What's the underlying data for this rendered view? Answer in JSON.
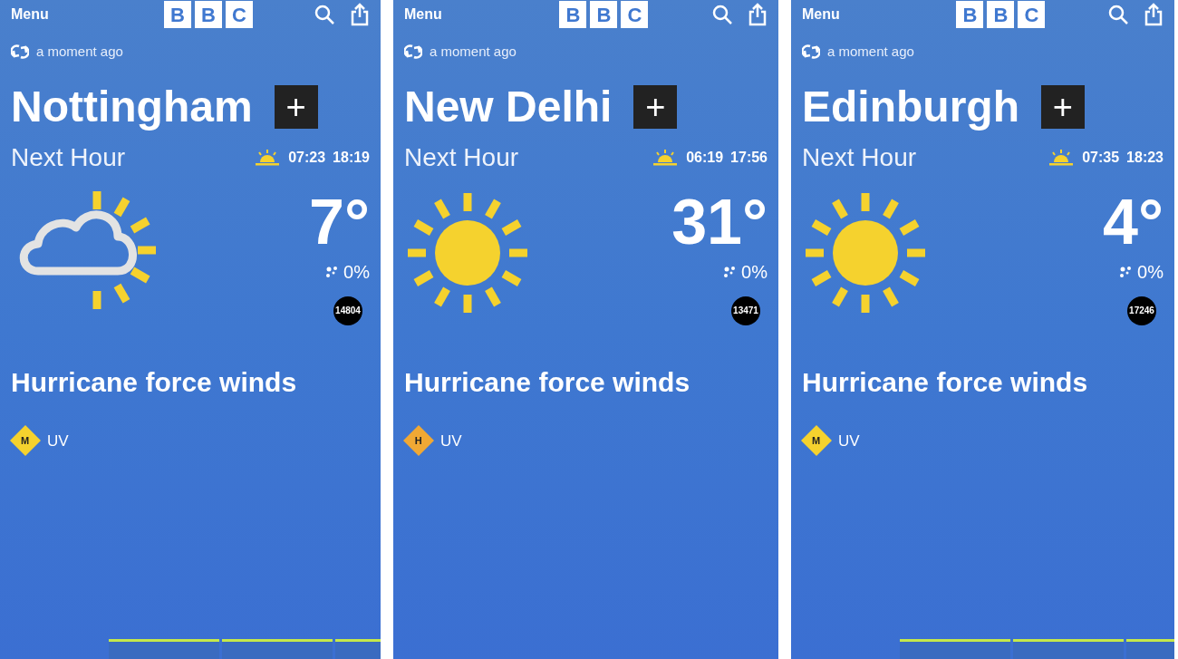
{
  "panels": [
    {
      "menu": "Menu",
      "logo": [
        "B",
        "B",
        "C"
      ],
      "updated": "a moment ago",
      "city": "Nottingham",
      "add": "+",
      "subtitle": "Next Hour",
      "sunrise": "07:23",
      "sunset": "18:19",
      "weather_icon": {
        "kind": "sun-cloud"
      },
      "temperature": "7°",
      "rain": "0%",
      "counter": "14804",
      "headline": "Hurricane force winds",
      "uv": {
        "level": "M",
        "label": "UV",
        "color": "#f5d22e"
      },
      "tab_strip": true
    },
    {
      "menu": "Menu",
      "logo": [
        "B",
        "B",
        "C"
      ],
      "updated": "a moment ago",
      "city": "New Delhi",
      "add": "+",
      "subtitle": "Next Hour",
      "sunrise": "06:19",
      "sunset": "17:56",
      "weather_icon": {
        "kind": "sun"
      },
      "temperature": "31°",
      "rain": "0%",
      "counter": "13471",
      "headline": "Hurricane force winds",
      "uv": {
        "level": "H",
        "label": "UV",
        "color": "#f0a834"
      },
      "tab_strip": false
    },
    {
      "menu": "Menu",
      "logo": [
        "B",
        "B",
        "C"
      ],
      "updated": "a moment ago",
      "city": "Edinburgh",
      "add": "+",
      "subtitle": "Next Hour",
      "sunrise": "07:35",
      "sunset": "18:23",
      "weather_icon": {
        "kind": "sun"
      },
      "temperature": "4°",
      "rain": "0%",
      "counter": "17246",
      "headline": "Hurricane force winds",
      "uv": {
        "level": "M",
        "label": "UV",
        "color": "#f5d22e"
      },
      "tab_strip": true
    }
  ]
}
